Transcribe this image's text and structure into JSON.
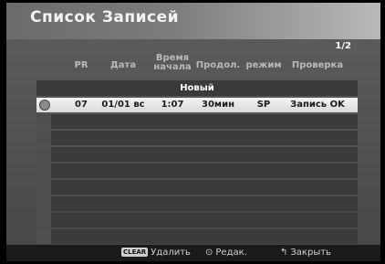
{
  "title": "Список Записей",
  "page_indicator": "1/2",
  "columns": {
    "pr": "PR",
    "date": "Дата",
    "start_time": "Время начала",
    "duration": "Продол.",
    "mode": "режим",
    "check": "Проверка"
  },
  "new_row_label": "Новый",
  "rows": [
    {
      "pr": "07",
      "date": "01/01 вс",
      "start_time": "1:07",
      "duration": "30мин",
      "mode": "SP",
      "check": "Запись OK"
    }
  ],
  "empty_rows": 8,
  "footer": {
    "clear_badge": "CLEAR",
    "delete_label": "Удалить",
    "edit_label": "Редак.",
    "close_label": "Закрыть"
  }
}
